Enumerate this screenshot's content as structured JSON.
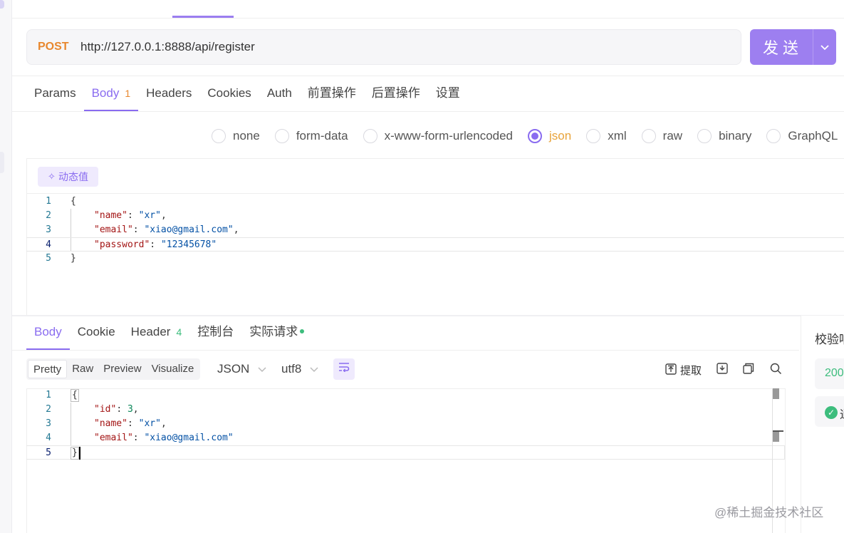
{
  "request": {
    "method": "POST",
    "url": "http://127.0.0.1:8888/api/register",
    "send_label": "发送",
    "tabs": [
      {
        "label": "Params"
      },
      {
        "label": "Body",
        "badge": "1"
      },
      {
        "label": "Headers"
      },
      {
        "label": "Cookies"
      },
      {
        "label": "Auth"
      },
      {
        "label": "前置操作"
      },
      {
        "label": "后置操作"
      },
      {
        "label": "设置"
      }
    ],
    "active_tab": "Body",
    "body_types": [
      "none",
      "form-data",
      "x-www-form-urlencoded",
      "json",
      "xml",
      "raw",
      "binary",
      "GraphQL"
    ],
    "selected_body_type": "json",
    "dynamic_value_label": "动态值",
    "body_code": {
      "line_numbers": [
        "1",
        "2",
        "3",
        "4",
        "5"
      ],
      "open_brace": "{",
      "close_brace": "}",
      "fields": [
        {
          "key": "\"name\"",
          "value": "\"xr\"",
          "comma": ","
        },
        {
          "key": "\"email\"",
          "value": "\"xiao@gmail.com\"",
          "comma": ","
        },
        {
          "key": "\"password\"",
          "value": "\"12345678\"",
          "comma": ""
        }
      ]
    }
  },
  "response": {
    "tabs": [
      {
        "label": "Body"
      },
      {
        "label": "Cookie"
      },
      {
        "label": "Header",
        "badge": "4"
      },
      {
        "label": "控制台"
      },
      {
        "label": "实际请求"
      }
    ],
    "active_tab": "Body",
    "view_modes": [
      "Pretty",
      "Raw",
      "Preview",
      "Visualize"
    ],
    "selected_view_mode": "Pretty",
    "format": "JSON",
    "encoding": "utf8",
    "extract_label": "提取",
    "body_code": {
      "line_numbers": [
        "1",
        "2",
        "3",
        "4",
        "5"
      ],
      "open_brace": "{",
      "close_brace": "}",
      "fields": [
        {
          "key": "\"id\"",
          "value": "3",
          "type": "number",
          "comma": ","
        },
        {
          "key": "\"name\"",
          "value": "\"xr\"",
          "type": "string",
          "comma": ","
        },
        {
          "key": "\"email\"",
          "value": "\"xiao@gmail.com\"",
          "type": "string",
          "comma": ""
        }
      ]
    },
    "side_panel": {
      "title": "校验响",
      "status_code": "200",
      "check_text": "通"
    }
  },
  "watermark": "@稀土掘金技术社区",
  "colors": {
    "accent": "#8a6cf0",
    "send_button": "#9d7ff0",
    "method": "#e8872e",
    "success": "#3dbd7d"
  }
}
